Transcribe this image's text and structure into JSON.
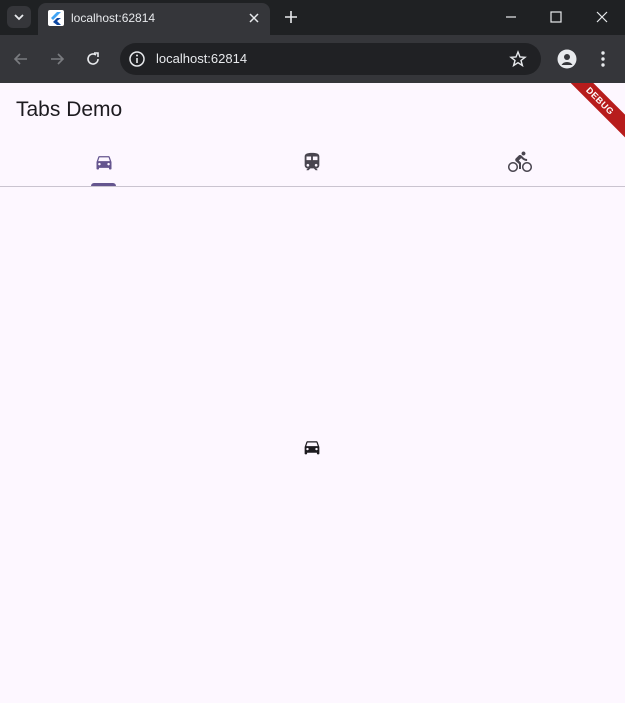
{
  "browser": {
    "tab_title": "localhost:62814",
    "url": "localhost:62814"
  },
  "app": {
    "title": "Tabs Demo",
    "debug_banner": "DEBUG",
    "tabs": [
      {
        "icon": "car-icon",
        "selected": true
      },
      {
        "icon": "train-icon",
        "selected": false
      },
      {
        "icon": "bike-icon",
        "selected": false
      }
    ],
    "content_icon": "car-icon"
  },
  "colors": {
    "selected_tab": "#65558f",
    "unselected_tab": "#49454f",
    "background": "#fdf7ff"
  }
}
